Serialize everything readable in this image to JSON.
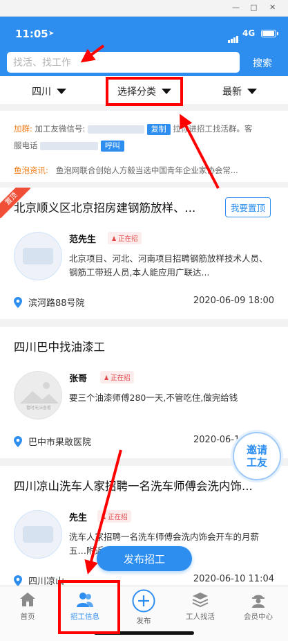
{
  "window": {
    "min": "—",
    "max": "□",
    "close": "✕"
  },
  "status": {
    "time": "11:05",
    "network": "4G"
  },
  "search": {
    "placeholder": "找活、找工作",
    "button": "搜索"
  },
  "filters": [
    {
      "label": "四川"
    },
    {
      "label": "选择分类"
    },
    {
      "label": "最新"
    }
  ],
  "notice": {
    "group_label": "加群:",
    "group_text_a": "加工友微信号:",
    "copy_btn": "复制",
    "group_text_b": "拉你进招工找活群。客",
    "service_text": "服电话",
    "call_btn": "呼叫",
    "news_label": "鱼泡资讯:",
    "news_text": "鱼泡网联合创始人方毅当选中国青年企业家协会常..."
  },
  "listings": [
    {
      "pinned": "置顶",
      "title": "北京顺义区北京招房建钢筋放样、...",
      "pin_button": "我要置顶",
      "contact": "范先生",
      "status": "正在招",
      "description": "北京项目、河北、河南项目招聘钢筋放样技术人员、钢筋工带班人员,本人能应用广联达...",
      "location": "滨河路88号院",
      "date": "2020-06-09 18:00"
    },
    {
      "title": "四川巴中找油漆工",
      "contact": "张哥",
      "status": "正在招",
      "avatar_caption": "暂时无法查看",
      "description": "要三个油漆师傅280一天,不管吃住,做完给钱",
      "location": "巴中市果敢医院",
      "date": "2020-06-1"
    },
    {
      "title": "四川凉山洗车人家招聘一名洗车师傅会洗内饰...",
      "contact": "先生",
      "status": "正在招",
      "description": "洗车人家招聘一名洗车师傅会洗内饰会开车的月薪五…附近,彩云府附近,...",
      "location": "四川凉山",
      "date": "2020-06-10 11:04"
    }
  ],
  "invite": {
    "text": "邀请工友"
  },
  "post_button": "发布招工",
  "tabs": [
    {
      "label": "首页"
    },
    {
      "label": "招工信息"
    },
    {
      "label": "发布"
    },
    {
      "label": "工人找活"
    },
    {
      "label": "会员中心"
    }
  ],
  "colors": {
    "primary": "#2d8ef0",
    "annotation": "#ff0000",
    "accent": "#f07c18"
  },
  "icons": [
    "location-arrow-icon",
    "signal-icon",
    "battery-icon",
    "triangle-down-icon",
    "map-pin-icon",
    "home-icon",
    "users-icon",
    "plus-circle-icon",
    "stack-icon",
    "worker-icon"
  ]
}
